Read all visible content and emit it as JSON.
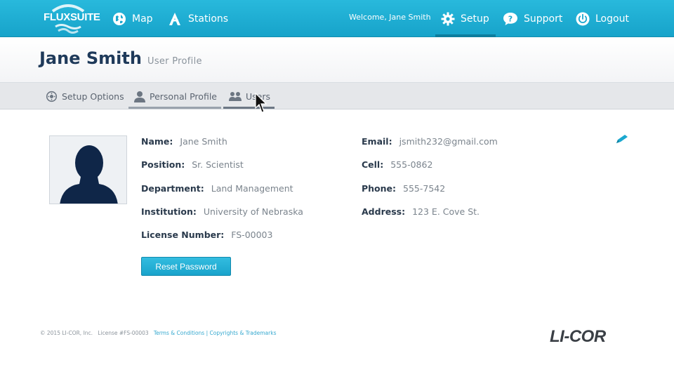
{
  "brand": {
    "logo_text": "FLUXSUITE",
    "accent": "#1aa8cf"
  },
  "nav": {
    "map_label": "Map",
    "stations_label": "Stations",
    "welcome": "Welcome, Jane Smith",
    "setup_label": "Setup",
    "support_label": "Support",
    "logout_label": "Logout",
    "active": "Setup"
  },
  "header": {
    "name": "Jane Smith",
    "subtitle": "User Profile"
  },
  "subtabs": {
    "setup_options": "Setup Options",
    "personal_profile": "Personal Profile",
    "users": "Users"
  },
  "profile": {
    "name_label": "Name:",
    "name": "Jane Smith",
    "position_label": "Position:",
    "position": "Sr. Scientist",
    "department_label": "Department:",
    "department": "Land Management",
    "institution_label": "Institution:",
    "institution": "University of Nebraska",
    "license_label": "License Number:",
    "license": "FS-00003",
    "email_label": "Email:",
    "email": "jsmith232@gmail.com",
    "cell_label": "Cell:",
    "cell": "555-0862",
    "phone_label": "Phone:",
    "phone": "555-7542",
    "address_label": "Address:",
    "address": "123 E. Cove St."
  },
  "reset_button": "Reset Password",
  "footer": {
    "copyright": "© 2015 LI-COR, Inc.",
    "license": "License #FS-00003",
    "terms": "Terms & Conditions",
    "separator": "|",
    "copyrights": "Copyrights & Trademarks"
  },
  "company_logo": "LI-COR",
  "icons": {
    "map": "globe-icon",
    "stations": "tower-icon",
    "setup": "gear-icon",
    "support": "question-icon",
    "logout": "power-icon",
    "edit": "pencil-icon"
  }
}
